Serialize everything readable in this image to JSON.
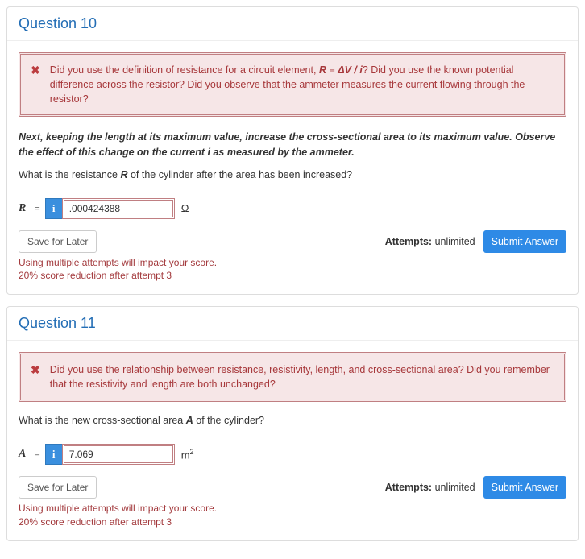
{
  "q10": {
    "title": "Question 10",
    "feedback_pre": "Did you use the definition of resistance for a circuit element, ",
    "feedback_formula": "R ≡ ΔV / i",
    "feedback_post": "? Did you use the known potential difference across the resistor? Did you observe that the ammeter measures the current flowing through the resistor?",
    "instruction": "Next, keeping the length at its maximum value, increase the cross-sectional area to its maximum value. Observe the effect of this change on the current i as measured by the ammeter.",
    "prompt_pre": "What is the resistance ",
    "prompt_sym": "R",
    "prompt_post": " of the cylinder after the area has been increased?",
    "lhs": "R",
    "value": ".000424388",
    "unit": "Ω",
    "save_label": "Save for Later",
    "attempts_label": "Attempts:",
    "attempts_value": "unlimited",
    "submit_label": "Submit Answer",
    "warn_line1": "Using multiple attempts will impact your score.",
    "warn_line2": "20% score reduction after attempt 3"
  },
  "q11": {
    "title": "Question 11",
    "feedback": "Did you use the relationship between resistance, resistivity, length, and cross-sectional area? Did you remember that the resistivity and length are both unchanged?",
    "prompt_pre": "What is the new cross-sectional area ",
    "prompt_sym": "A",
    "prompt_post": " of the cylinder?",
    "lhs": "A",
    "value": "7.069",
    "unit_base": "m",
    "unit_sup": "2",
    "save_label": "Save for Later",
    "attempts_label": "Attempts:",
    "attempts_value": "unlimited",
    "submit_label": "Submit Answer",
    "warn_line1": "Using multiple attempts will impact your score.",
    "warn_line2": "20% score reduction after attempt 3"
  },
  "info_glyph": "i",
  "x_glyph": "✖"
}
